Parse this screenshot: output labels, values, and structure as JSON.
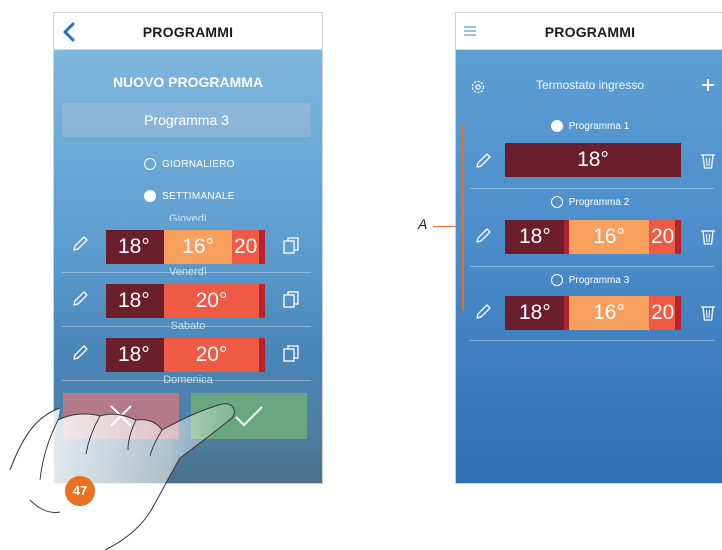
{
  "left_screen": {
    "header_title": "PROGRAMMI",
    "screen_title": "NUOVO PROGRAMMA",
    "program_name": "Programma 3",
    "radio_options": [
      {
        "label": "GIORNALIERO",
        "selected": false
      },
      {
        "label": "SETTIMANALE",
        "selected": true
      }
    ],
    "days": [
      {
        "label": "Giovedì",
        "segments": [
          "18°",
          "16°",
          "20"
        ]
      },
      {
        "label": "Venerdì",
        "segments": [
          "18°",
          "20°"
        ]
      },
      {
        "label": "Sabato",
        "segments": [
          "18°",
          "20°"
        ]
      },
      {
        "label": "Domenica"
      }
    ]
  },
  "right_screen": {
    "header_title": "PROGRAMMI",
    "thermostat_name": "Termostato ingresso",
    "programs": [
      {
        "label": "Programma 1",
        "selected": true,
        "segments": [
          "18°"
        ]
      },
      {
        "label": "Programma 2",
        "selected": false,
        "segments": [
          "18°",
          "16°",
          "20°"
        ]
      },
      {
        "label": "Programma 3",
        "selected": false,
        "segments": [
          "18°",
          "16°",
          "20°"
        ]
      }
    ]
  },
  "annotations": {
    "step_badge": "47",
    "callout_letter": "A"
  },
  "colors": {
    "dark": "#6b1f2c",
    "orange": "#f7a05d",
    "red": "#ee5a44",
    "maroon": "#b1222d",
    "accent": "#e8701f",
    "back_blue": "#1f6fd1"
  }
}
